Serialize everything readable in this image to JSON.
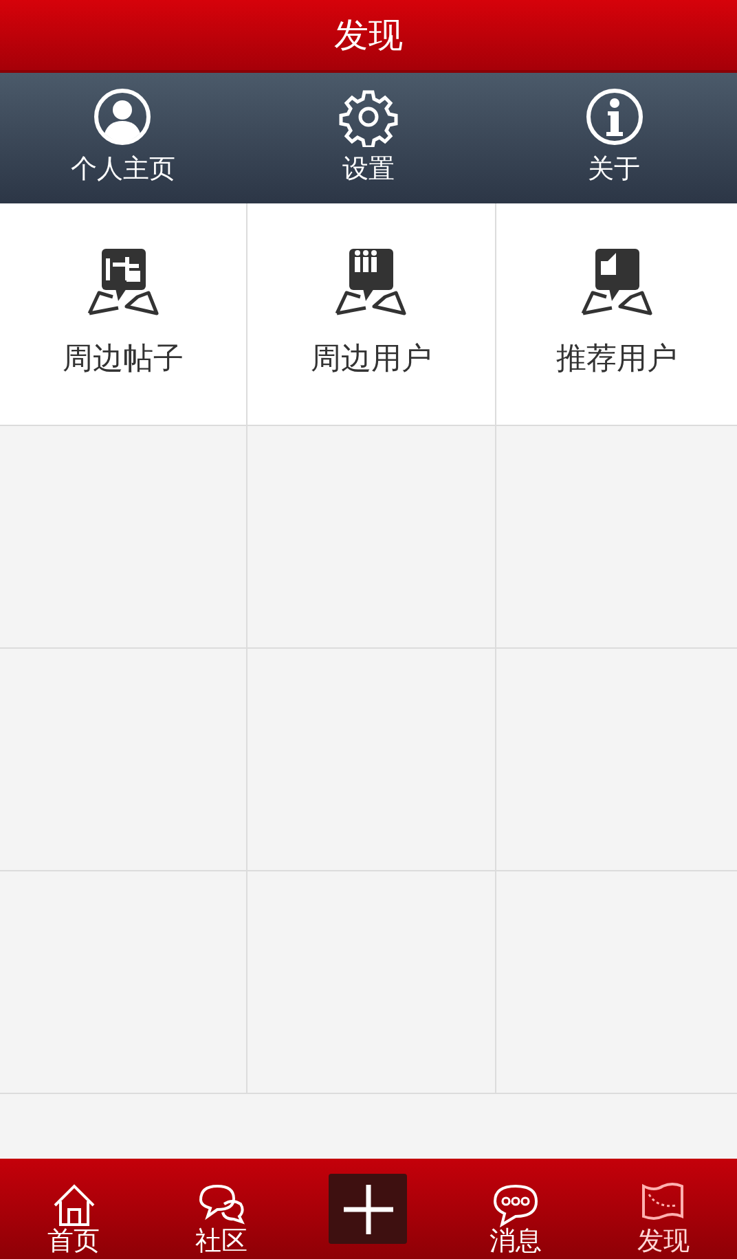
{
  "header": {
    "title": "发现"
  },
  "quick_links": [
    {
      "kind": "profile",
      "label": "个人主页"
    },
    {
      "kind": "settings",
      "label": "设置"
    },
    {
      "kind": "about",
      "label": "关于"
    }
  ],
  "grid_items": [
    {
      "kind": "posts",
      "label": "周边帖子"
    },
    {
      "kind": "users",
      "label": "周边用户"
    },
    {
      "kind": "recommend",
      "label": "推荐用户"
    }
  ],
  "bottom_tabs": [
    {
      "kind": "home",
      "label": "首页",
      "selected": false
    },
    {
      "kind": "community",
      "label": "社区",
      "selected": false
    },
    {
      "kind": "add",
      "selected": false
    },
    {
      "kind": "messages",
      "label": "消息",
      "selected": false
    },
    {
      "kind": "discover",
      "label": "发现",
      "selected": true
    }
  ]
}
